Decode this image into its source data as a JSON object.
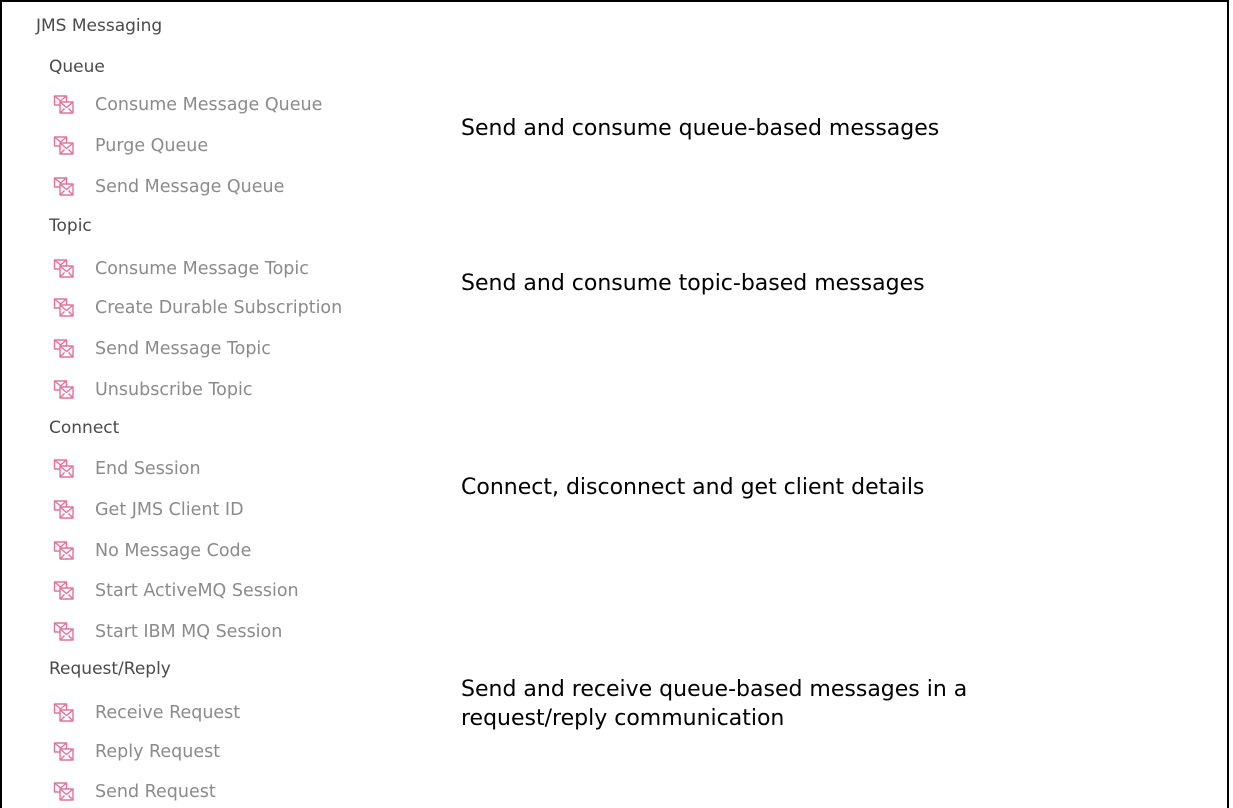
{
  "root": {
    "title": "JMS Messaging"
  },
  "colors": {
    "icon": "#e2729b",
    "item_text": "#8b8b8b",
    "group_text": "#4a4a4a"
  },
  "groups": [
    {
      "title": "Queue",
      "items": [
        {
          "label": "Consume Message Queue",
          "icon": "jms-message-icon"
        },
        {
          "label": "Purge Queue",
          "icon": "jms-message-icon"
        },
        {
          "label": "Send Message Queue",
          "icon": "jms-message-icon"
        }
      ],
      "description": "Send and consume queue-based messages"
    },
    {
      "title": "Topic",
      "items": [
        {
          "label": "Consume Message Topic",
          "icon": "jms-message-icon"
        },
        {
          "label": "Create Durable Subscription",
          "icon": "jms-message-icon"
        },
        {
          "label": "Send Message Topic",
          "icon": "jms-message-icon"
        },
        {
          "label": "Unsubscribe Topic",
          "icon": "jms-message-icon"
        }
      ],
      "description": "Send and consume topic-based messages"
    },
    {
      "title": "Connect",
      "items": [
        {
          "label": "End Session",
          "icon": "jms-message-icon"
        },
        {
          "label": "Get JMS Client ID",
          "icon": "jms-message-icon"
        },
        {
          "label": "No Message Code",
          "icon": "jms-message-icon"
        },
        {
          "label": "Start ActiveMQ Session",
          "icon": "jms-message-icon"
        },
        {
          "label": "Start IBM MQ Session",
          "icon": "jms-message-icon"
        }
      ],
      "description": "Connect, disconnect and get client details"
    },
    {
      "title": "Request/Reply",
      "items": [
        {
          "label": "Receive Request",
          "icon": "jms-message-icon"
        },
        {
          "label": "Reply Request",
          "icon": "jms-message-icon"
        },
        {
          "label": "Send Request",
          "icon": "jms-message-icon"
        }
      ],
      "description_lines": [
        "Send and receive queue-based messages in a",
        "request/reply communication"
      ]
    }
  ]
}
